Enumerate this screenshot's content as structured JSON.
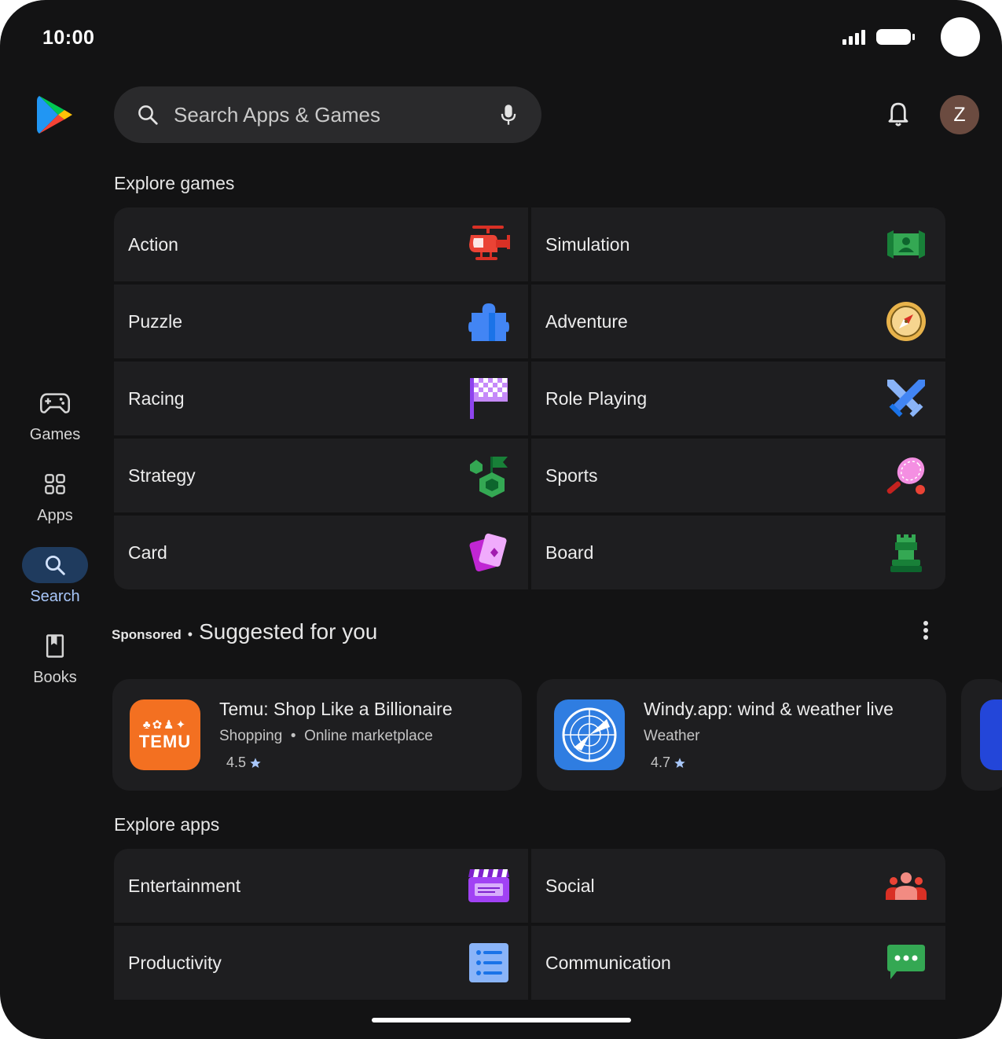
{
  "status_bar": {
    "time": "10:00"
  },
  "search": {
    "placeholder": "Search Apps & Games"
  },
  "profile": {
    "initial": "Z"
  },
  "rail": [
    {
      "label": "Games",
      "icon": "gamepad-icon"
    },
    {
      "label": "Apps",
      "icon": "apps-grid-icon"
    },
    {
      "label": "Search",
      "icon": "search-icon",
      "active": true
    },
    {
      "label": "Books",
      "icon": "book-icon"
    }
  ],
  "explore_games": {
    "title": "Explore games",
    "categories": [
      {
        "label": "Action",
        "icon": "helicopter-icon"
      },
      {
        "label": "Simulation",
        "icon": "simulation-icon"
      },
      {
        "label": "Puzzle",
        "icon": "puzzle-piece-icon"
      },
      {
        "label": "Adventure",
        "icon": "compass-icon"
      },
      {
        "label": "Racing",
        "icon": "checkered-flag-icon"
      },
      {
        "label": "Role Playing",
        "icon": "crossed-swords-icon"
      },
      {
        "label": "Strategy",
        "icon": "strategy-icon"
      },
      {
        "label": "Sports",
        "icon": "tennis-racket-icon"
      },
      {
        "label": "Card",
        "icon": "cards-icon"
      },
      {
        "label": "Board",
        "icon": "chess-piece-icon"
      }
    ]
  },
  "suggested": {
    "sponsored_label": "Sponsored",
    "separator": "•",
    "title": "Suggested for you",
    "apps": [
      {
        "name": "Temu: Shop Like a Billionaire",
        "category": "Shopping",
        "subcategory": "Online marketplace",
        "rating": "4.5",
        "icon_text": "TEMU",
        "color": "#f37021"
      },
      {
        "name": "Windy.app: wind & weather live",
        "category": "Weather",
        "rating": "4.7",
        "color": "#2f7de1"
      }
    ]
  },
  "explore_apps": {
    "title": "Explore apps",
    "categories": [
      {
        "label": "Entertainment",
        "icon": "clapperboard-icon"
      },
      {
        "label": "Social",
        "icon": "people-icon"
      },
      {
        "label": "Productivity",
        "icon": "checklist-icon"
      },
      {
        "label": "Communication",
        "icon": "chat-bubble-icon"
      }
    ]
  }
}
